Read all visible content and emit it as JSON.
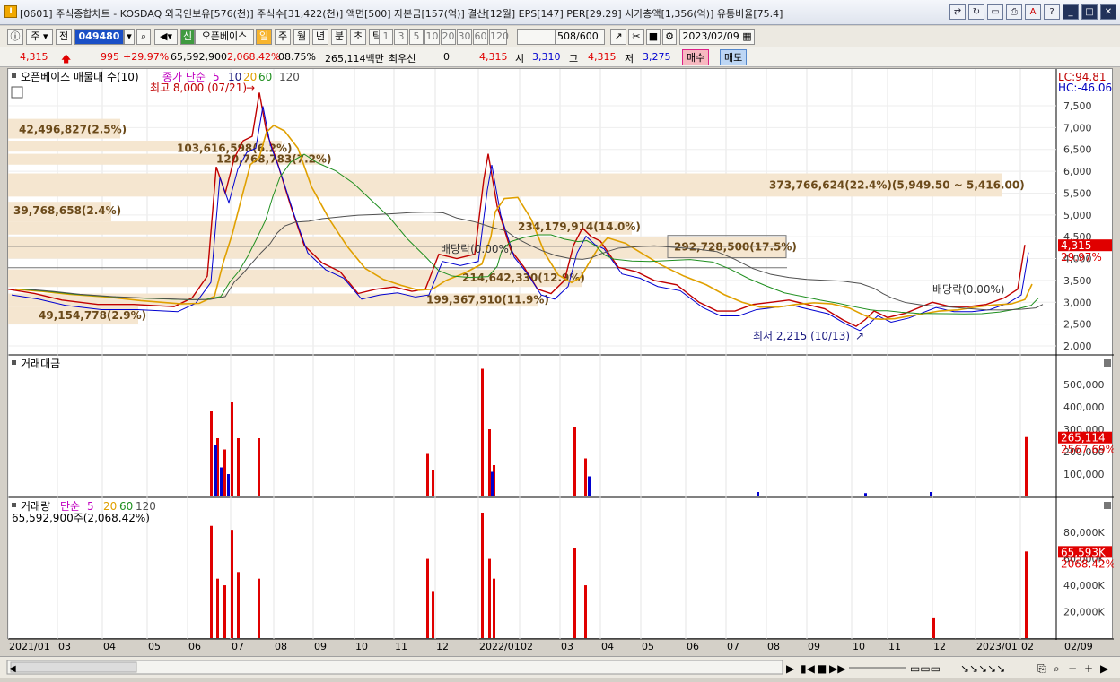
{
  "window": {
    "title": "[0601] 주식종합차트 - KOSDAQ 외국인보유[576(천)] 주식수[31,422(천)] 액면[500] 자본금[157(억)] 결산[12월] EPS[147] PER[29.29] 시가총액[1,356(억)] 유통비율[75.4]"
  },
  "toolbar": {
    "period_select": "주",
    "jeon_label": "전",
    "code_value": "049480",
    "base_label": "신",
    "base_name": "오픈베이스",
    "periods": [
      "일",
      "주",
      "월",
      "년",
      "분",
      "초",
      "틱"
    ],
    "intervals": [
      "1",
      "3",
      "5",
      "10",
      "20",
      "30",
      "60",
      "120"
    ],
    "count_value": "508",
    "count_total": "/600",
    "date_value": "2023/02/09"
  },
  "infobar": {
    "price": "4,315",
    "change": "995",
    "change_pct": "+29.97%",
    "volume": "65,592,900",
    "volume_pct": "2,068.42%",
    "turnover_pct": "08.75%",
    "amount": "265,114백만",
    "priority_label": "최우선",
    "priority_value": "0",
    "ask": "4,315",
    "open_label": "시",
    "open_value": "3,310",
    "high_label": "고",
    "high_value": "4,315",
    "low_label": "저",
    "low_value": "3,275",
    "buy_label": "매수",
    "sell_label": "매도"
  },
  "price_panel": {
    "legend_name": "오픈베이스 매물대 수(10)",
    "ma_label": "종가 단순",
    "ma_periods": [
      "5",
      "10",
      "20",
      "60",
      "120"
    ],
    "lc": "LC:94.81",
    "hc": "HC:-46.06",
    "current_price": "4,315",
    "current_pct": "29.97%",
    "high_note": "최고 8,000 (07/21)",
    "low_note": "최저 2,215 (10/13)",
    "dividend1": "배당락(0.00%)",
    "dividend2": "배당락(0.00%)",
    "volume_profile": [
      "42,496,827(2.5%)",
      "103,616,598(6.2%)",
      "120,768,783(7.2%)",
      "373,766,624(22.4%)(5,949.50 ~ 5,416.00)",
      "39,768,658(2.4%)",
      "234,179,914(14.0%)",
      "292,728,500(17.5%)",
      "214,642,330(12.9%)",
      "199,367,910(11.9%)",
      "49,154,778(2.9%)"
    ],
    "y_ticks": [
      "7,500",
      "7,000",
      "6,500",
      "6,000",
      "5,500",
      "5,000",
      "4,500",
      "4,000",
      "3,500",
      "3,000",
      "2,500",
      "2,000"
    ]
  },
  "amount_panel": {
    "title": "거래대금",
    "current": "265,114",
    "current_pct": "2567.69%",
    "y_ticks": [
      "500,000",
      "400,000",
      "300,000",
      "200,000",
      "100,000"
    ]
  },
  "volume_panel": {
    "title": "거래량",
    "ma_label": "단순",
    "ma_periods": [
      "5",
      "20",
      "60",
      "120"
    ],
    "summary": "65,592,900주(2,068.42%)",
    "current": "65,593K",
    "current_pct": "2068.42%",
    "y_ticks": [
      "80,000K",
      "60,000K",
      "40,000K",
      "20,000K"
    ]
  },
  "x_axis": [
    "2021/01",
    "03",
    "04",
    "05",
    "06",
    "07",
    "08",
    "09",
    "10",
    "11",
    "12",
    "2022/01",
    "02",
    "03",
    "04",
    "05",
    "06",
    "07",
    "08",
    "09",
    "10",
    "11",
    "12",
    "2023/01",
    "02"
  ],
  "x_axis_right": "02/09",
  "colors": {
    "up": "#e00000",
    "down": "#0000d0",
    "profile": "#f5e6d0",
    "ma5": "#c000c0",
    "ma10": "#1a1a80",
    "ma20": "#e0a000",
    "ma60": "#1f8f1f",
    "ma120": "#505050"
  }
}
